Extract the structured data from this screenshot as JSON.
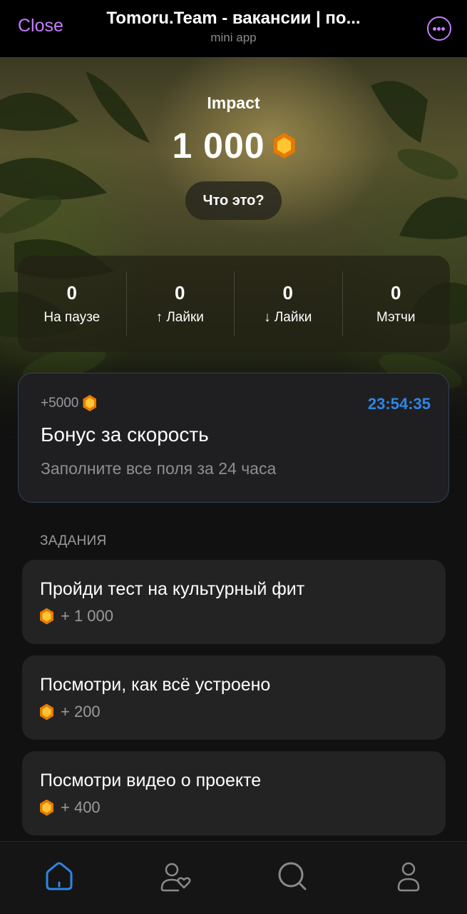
{
  "topbar": {
    "close_label": "Close",
    "title": "Tomoru.Team - вакансии | по...",
    "subtitle": "mini app"
  },
  "hero": {
    "impact_label": "Impact",
    "impact_value": "1 000",
    "what_button": "Что это?"
  },
  "stats": [
    {
      "value": "0",
      "label": "На паузе"
    },
    {
      "value": "0",
      "label": "↑ Лайки"
    },
    {
      "value": "0",
      "label": "↓ Лайки"
    },
    {
      "value": "0",
      "label": "Мэтчи"
    }
  ],
  "bonus": {
    "reward": "+5000",
    "timer": "23:54:35",
    "title": "Бонус за скорость",
    "subtitle": "Заполните все поля за 24 часа"
  },
  "tasks_section": {
    "title": "ЗАДАНИЯ",
    "items": [
      {
        "title": "Пройди тест на культурный фит",
        "reward": "+ 1 000"
      },
      {
        "title": "Посмотри, как всё устроено",
        "reward": "+ 200"
      },
      {
        "title": "Посмотри видео о проекте",
        "reward": "+ 400"
      }
    ]
  },
  "nav": {
    "items": [
      {
        "icon": "home-icon",
        "active": true
      },
      {
        "icon": "matches-icon",
        "active": false
      },
      {
        "icon": "search-icon",
        "active": false
      },
      {
        "icon": "profile-icon",
        "active": false
      }
    ]
  },
  "colors": {
    "accent_purple": "#c77dff",
    "accent_blue": "#2d86e6",
    "gem_orange": "#e87a00",
    "background": "#111111"
  }
}
